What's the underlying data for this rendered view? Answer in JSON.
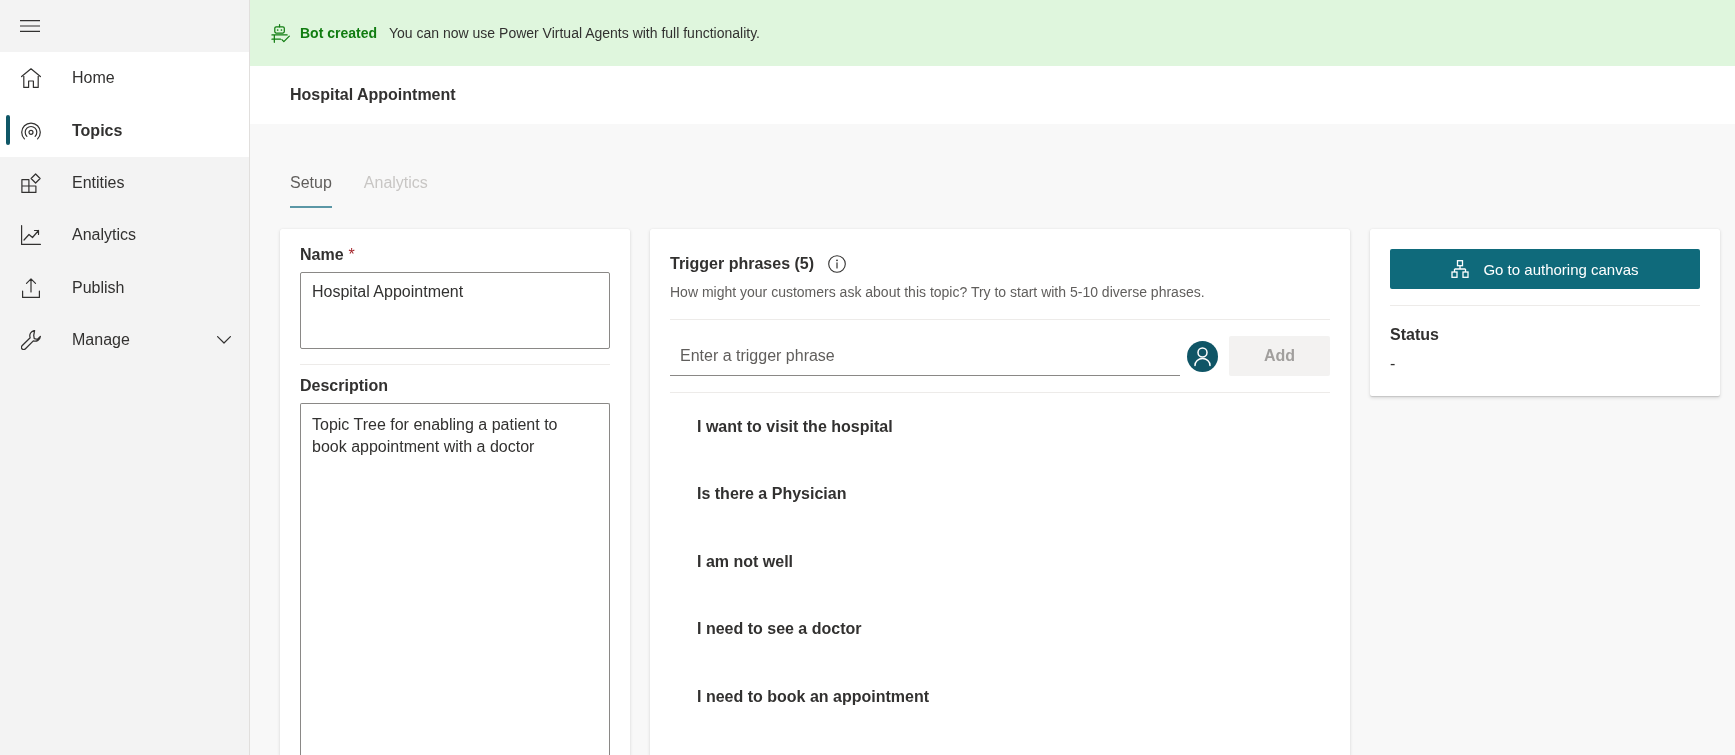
{
  "sidebar": {
    "items": [
      {
        "label": "Home",
        "kind": "page",
        "selected": false,
        "hovered": true
      },
      {
        "label": "Topics",
        "kind": "page",
        "selected": true,
        "hovered": false
      },
      {
        "label": "Entities",
        "kind": "page",
        "selected": false,
        "hovered": false
      },
      {
        "label": "Analytics",
        "kind": "page",
        "selected": false,
        "hovered": false
      },
      {
        "label": "Publish",
        "kind": "page",
        "selected": false,
        "hovered": false
      },
      {
        "label": "Manage",
        "kind": "group",
        "selected": false,
        "hovered": false,
        "expanded": false
      }
    ]
  },
  "banner": {
    "title": "Bot created",
    "message": "You can now use Power Virtual Agents with full functionality."
  },
  "header": {
    "title": "Hospital Appointment"
  },
  "tabs": [
    {
      "label": "Setup",
      "selected": true,
      "disabled": false
    },
    {
      "label": "Analytics",
      "selected": false,
      "disabled": true
    }
  ],
  "details": {
    "name": {
      "label": "Name",
      "required_mark": "*",
      "value": "Hospital Appointment"
    },
    "description": {
      "label": "Description",
      "value": "Topic Tree for enabling a patient to book appointment with a doctor"
    }
  },
  "trigger_phrases": {
    "title": "Trigger phrases (5)",
    "hint": "How might your customers ask about this topic? Try to start with 5-10 diverse phrases.",
    "input": {
      "placeholder": "Enter a trigger phrase"
    },
    "add_button": {
      "label": "Add",
      "disabled": true
    },
    "phrases": [
      "I want to visit the hospital",
      "Is there a Physician",
      "I am not well",
      "I need to see a doctor",
      "I need to book an appointment"
    ]
  },
  "status_panel": {
    "button": {
      "label": "Go to authoring canvas"
    },
    "status_label": "Status",
    "status_value": "-"
  }
}
